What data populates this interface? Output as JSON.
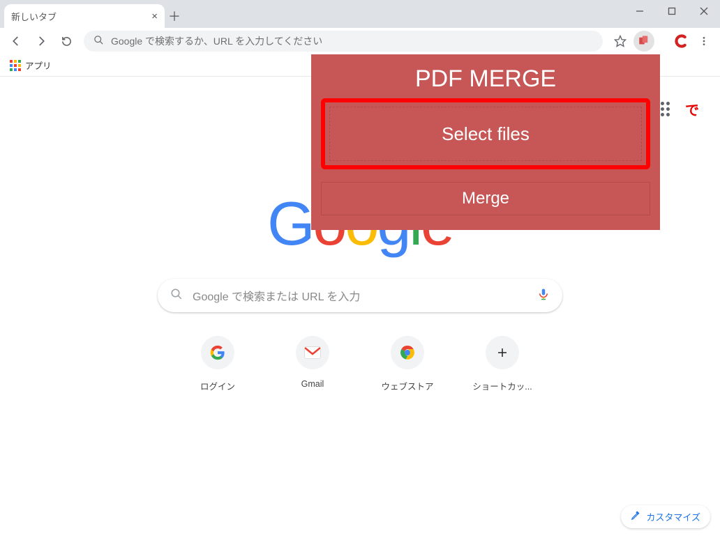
{
  "window": {
    "tab_title": "新しいタブ"
  },
  "toolbar": {
    "omnibox_placeholder": "Google で検索するか、URL を入力してください"
  },
  "bookmarks": {
    "apps_label": "アプリ"
  },
  "content": {
    "google_letters": [
      "G",
      "o",
      "o",
      "g",
      "l",
      "e"
    ],
    "search_placeholder": "Google で検索または URL を入力",
    "avatar_char": "で",
    "shortcuts": [
      {
        "label": "ログイン",
        "icon": "google"
      },
      {
        "label": "Gmail",
        "icon": "gmail"
      },
      {
        "label": "ウェブストア",
        "icon": "webstore"
      },
      {
        "label": "ショートカッ...",
        "icon": "add"
      }
    ],
    "customize_label": "カスタマイズ"
  },
  "popup": {
    "title": "PDF MERGE",
    "select_label": "Select files",
    "merge_label": "Merge"
  }
}
